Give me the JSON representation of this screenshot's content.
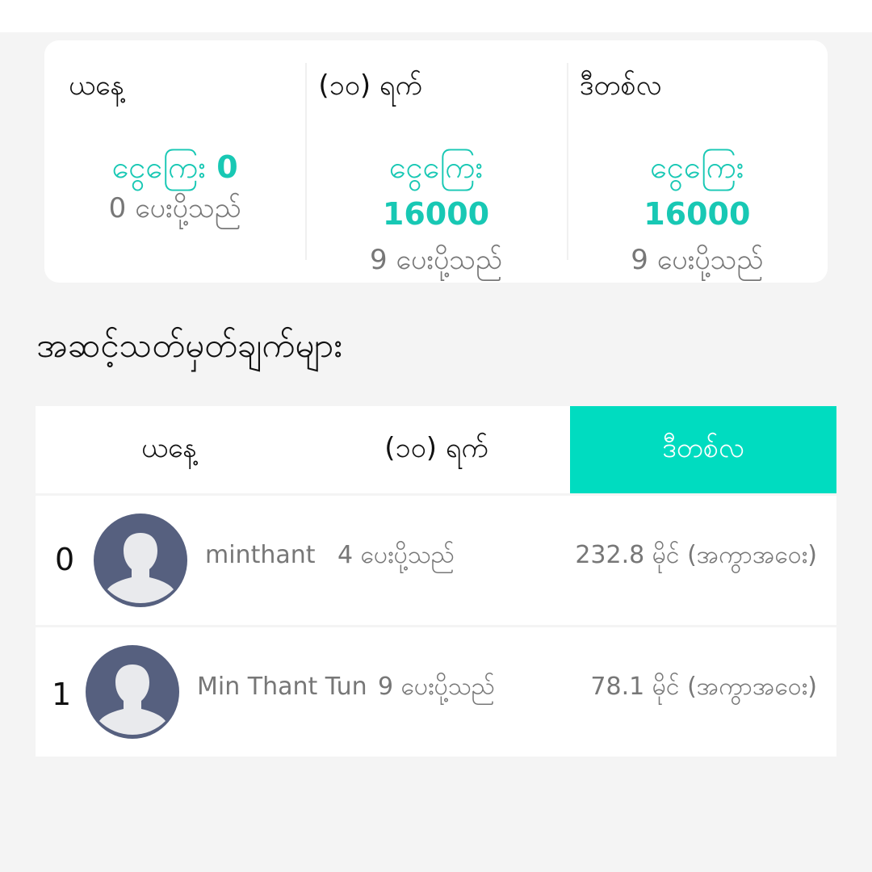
{
  "summary": [
    {
      "period": "ယနေ့",
      "money_label": "ငွေကြေး",
      "money_value": "0",
      "count_text": "0 ပေးပို့သည်"
    },
    {
      "period": "(၁၀) ရက်",
      "money_label": "ငွေကြေး",
      "money_value": "16000",
      "count_text": "9 ပေးပို့သည်"
    },
    {
      "period": "ဒီတစ်လ",
      "money_label": "ငွေကြေး",
      "money_value": "16000",
      "count_text": "9 ပေးပို့သည်"
    }
  ],
  "section_title": "အဆင့်သတ်မှတ်ချက်များ",
  "tabs": [
    {
      "label": "ယနေ့",
      "active": false
    },
    {
      "label": "(၁၀) ရက်",
      "active": false
    },
    {
      "label": "ဒီတစ်လ",
      "active": true
    }
  ],
  "rankings": [
    {
      "rank": "0",
      "name": "minthant",
      "given": "4 ပေးပို့သည်",
      "distance": "232.8 မိုင် (အကွာအဝေး)"
    },
    {
      "rank": "1",
      "name": "Min Thant Tun",
      "given": "9 ပေးပို့သည်",
      "distance": "78.1 မိုင် (အကွာအဝေး)"
    }
  ],
  "colors": {
    "accent": "#00dcc0",
    "money_text": "#18c8b4",
    "avatar_bg": "#56607f",
    "page_bg": "#f4f4f4"
  },
  "icons": {
    "avatar": "user-silhouette-icon"
  }
}
